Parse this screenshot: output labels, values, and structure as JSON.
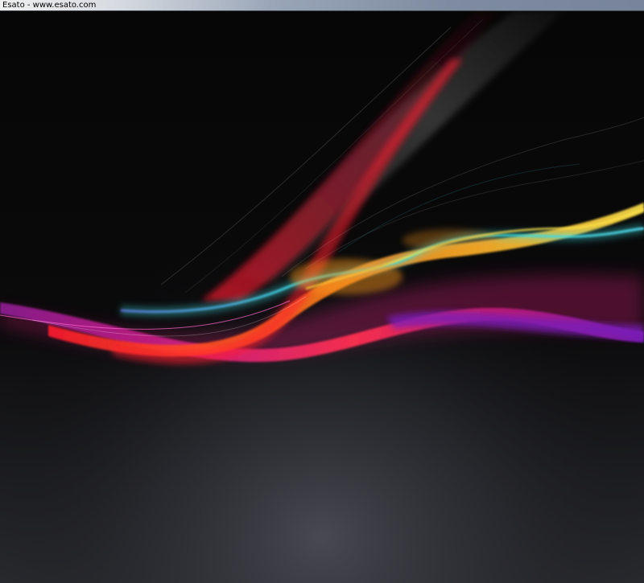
{
  "window": {
    "title": "Esato - www.esato.com"
  },
  "wallpaper": {
    "colors": {
      "background_top": "#050505",
      "background_bottom": "#3e3f46",
      "cyan": "#3fe0e6",
      "orange": "#ff9a1c",
      "yellow": "#ffe34a",
      "red": "#ff1a2e",
      "magenta": "#d0207f",
      "purple": "#7a1fb8",
      "violet": "#5a1a9a"
    }
  }
}
